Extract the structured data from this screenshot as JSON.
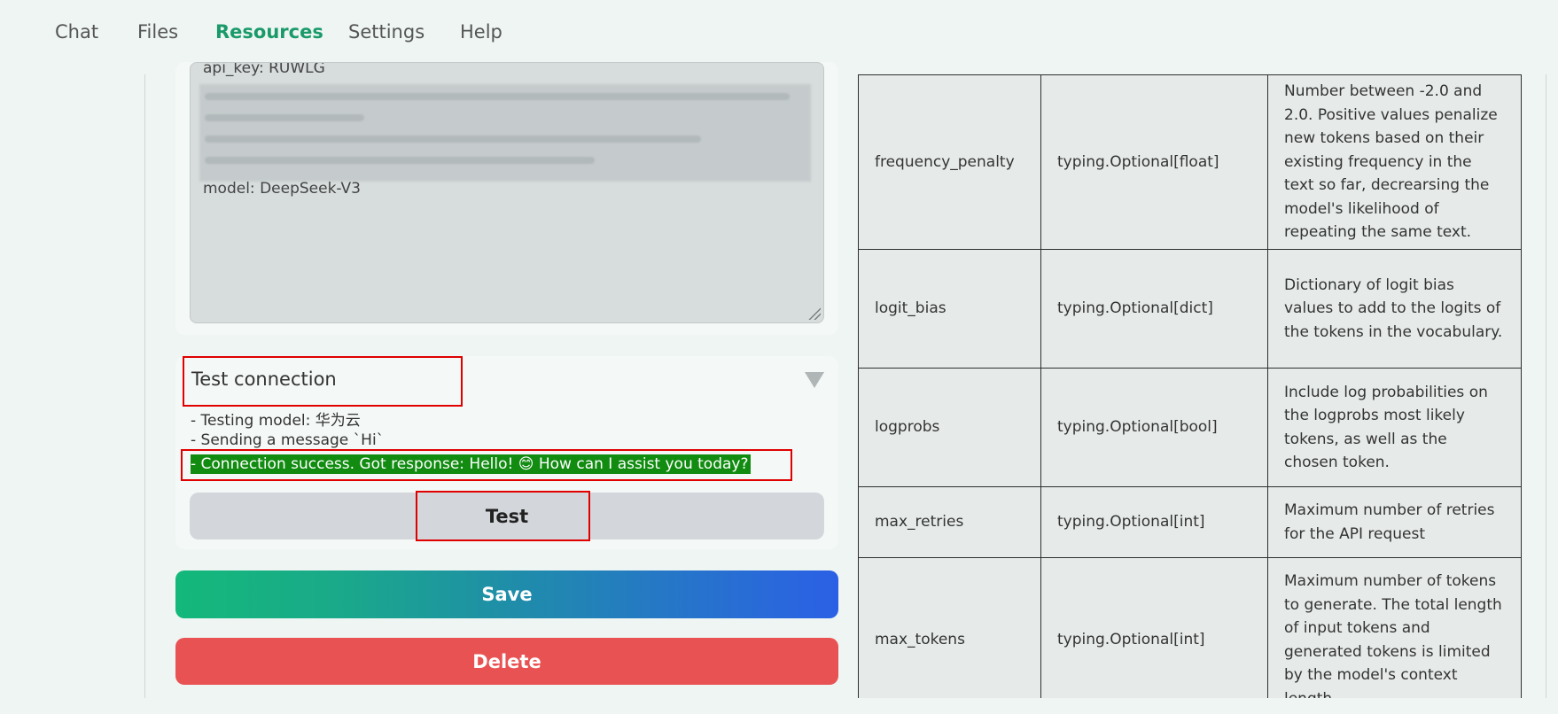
{
  "nav": {
    "items": [
      {
        "label": "Chat",
        "active": false
      },
      {
        "label": "Files",
        "active": false
      },
      {
        "label": "Resources",
        "active": true
      },
      {
        "label": "Settings",
        "active": false
      },
      {
        "label": "Help",
        "active": false
      }
    ]
  },
  "config": {
    "line_top": "api_key: RUWLG",
    "line_model": "model: DeepSeek-V3"
  },
  "test_connection": {
    "title": "Test connection",
    "log": [
      "- Testing model: 华为云",
      "- Sending a message `Hi`",
      "- Connection success. Got response: Hello! 😊 How can I assist you today?"
    ],
    "test_label": "Test"
  },
  "actions": {
    "save_label": "Save",
    "delete_label": "Delete"
  },
  "colors": {
    "accent": "#1a9a6a",
    "success_bg": "#118c11",
    "delete_bg": "#e95252",
    "highlight_border": "#e00000"
  },
  "params": {
    "rows": [
      {
        "name": "frequency_penalty",
        "type": "typing.Optional[float]",
        "description": "Number between -2.0 and 2.0. Positive values penalize new tokens based on their existing frequency in the text so far, decrearsing the model's likelihood of repeating the same text."
      },
      {
        "name": "logit_bias",
        "type": "typing.Optional[dict]",
        "description": "Dictionary of logit bias values to add to the logits of the tokens in the vocabulary."
      },
      {
        "name": "logprobs",
        "type": "typing.Optional[bool]",
        "description": "Include log probabilities on the logprobs most likely tokens, as well as the chosen token."
      },
      {
        "name": "max_retries",
        "type": "typing.Optional[int]",
        "description": "Maximum number of retries for the API request"
      },
      {
        "name": "max_tokens",
        "type": "typing.Optional[int]",
        "description": "Maximum number of tokens to generate. The total length of input tokens and generated tokens is limited by the model's context length."
      }
    ]
  }
}
